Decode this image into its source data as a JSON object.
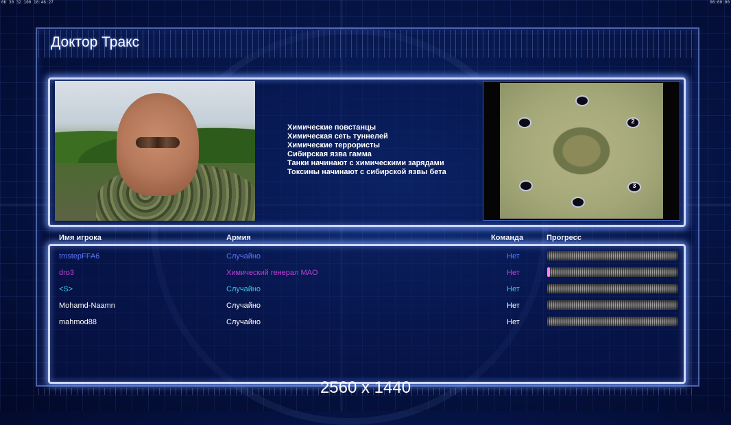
{
  "status_bar": {
    "left": "0K 30 32 100 10:46:27",
    "right": "00:00:00"
  },
  "title": "Доктор Тракс",
  "rules": [
    "Химические повстанцы",
    "Химическая сеть туннелей",
    "Химические террористы",
    "Сибирская язва гамма",
    "Танки начинают с химическими зарядами",
    "Токсины начинают с сибирской язвы бета"
  ],
  "minimap": {
    "spawn_labels": [
      "2",
      "3"
    ]
  },
  "table": {
    "headers": {
      "name": "Имя игрока",
      "army": "Армия",
      "team": "Команда",
      "progress": "Прогресс"
    },
    "rows": [
      {
        "name": "tmstepFFA6",
        "army": "Случайно",
        "team": "Нет",
        "progress": 0,
        "name_color": "#5a78ff",
        "army_color": "#5a78ff",
        "team_color": "#5a78ff"
      },
      {
        "name": "dro3",
        "army": "Химический генерал MAO",
        "team": "Нет",
        "progress": 0.02,
        "name_color": "#c23fd6",
        "army_color": "#c23fd6",
        "team_color": "#c23fd6"
      },
      {
        "name": "<S>",
        "army": "Случайно",
        "team": "Нет",
        "progress": 0,
        "name_color": "#3ec8e6",
        "army_color": "#3ec8e6",
        "team_color": "#3ec8e6"
      },
      {
        "name": "Mohamd-Naamn",
        "army": "Случайно",
        "team": "Нет",
        "progress": 0,
        "name_color": "#ffffff",
        "army_color": "#ffffff",
        "team_color": "#ffffff"
      },
      {
        "name": "mahmod88",
        "army": "Случайно",
        "team": "Нет",
        "progress": 0,
        "name_color": "#ffffff",
        "army_color": "#ffffff",
        "team_color": "#ffffff"
      }
    ]
  },
  "resolution_label": "2560 x 1440"
}
